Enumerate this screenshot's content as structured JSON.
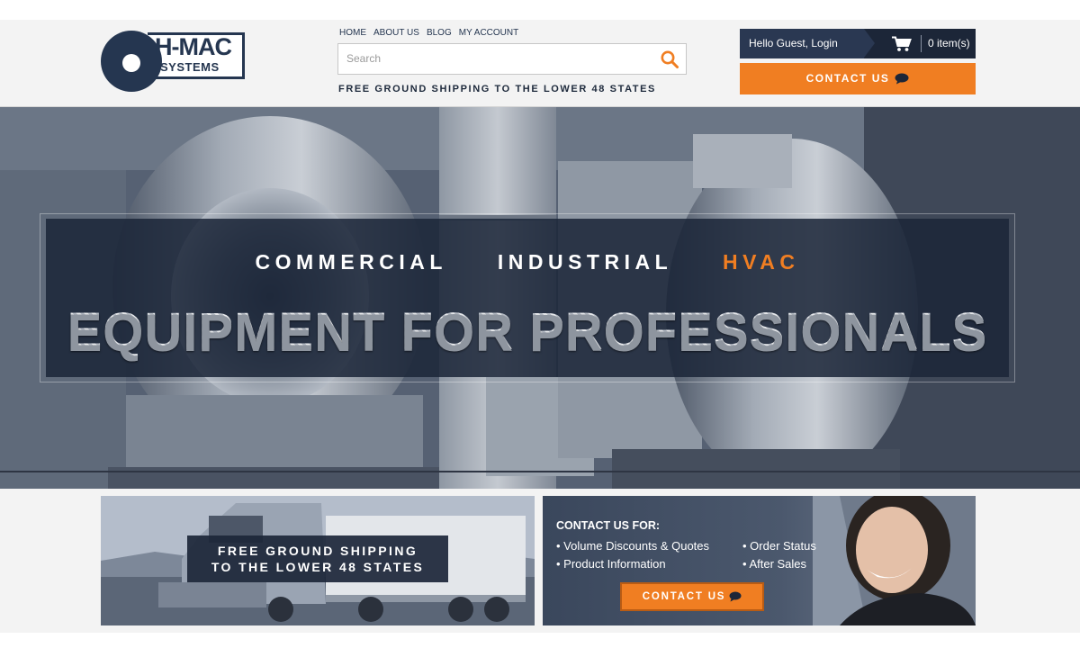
{
  "brand": {
    "logo_main": "H-MAC",
    "logo_sub": "SYSTEMS"
  },
  "top_nav": [
    {
      "label": "HOME"
    },
    {
      "label": "ABOUT US"
    },
    {
      "label": "BLOG"
    },
    {
      "label": "MY ACCOUNT"
    }
  ],
  "search": {
    "placeholder": "Search",
    "value": ""
  },
  "shipping_tagline": "FREE GROUND SHIPPING TO THE LOWER 48 STATES",
  "account": {
    "greeting": "Hello Guest,",
    "login_label": "Login",
    "cart_count_label": "0 item(s)"
  },
  "header_contact_label": "CONTACT US",
  "hero": {
    "kicker_1": "COMMERCIAL",
    "kicker_2": "INDUSTRIAL",
    "kicker_3": "HVAC",
    "title": "EQUIPMENT FOR PROFESSIONALS"
  },
  "promo_shipping": {
    "line1": "FREE GROUND SHIPPING",
    "line2": "TO THE LOWER 48 STATES"
  },
  "promo_contact": {
    "title": "CONTACT US FOR:",
    "items_left": [
      "• Volume Discounts & Quotes",
      "• Product Information"
    ],
    "items_right": [
      "• Order Status",
      "• After Sales"
    ],
    "button_label": "CONTACT US"
  },
  "colors": {
    "accent": "#f07e22",
    "navy": "#253650",
    "dark_navy": "#1c2638"
  },
  "icons": [
    "search-icon",
    "cart-icon",
    "chat-bubble-icon"
  ]
}
